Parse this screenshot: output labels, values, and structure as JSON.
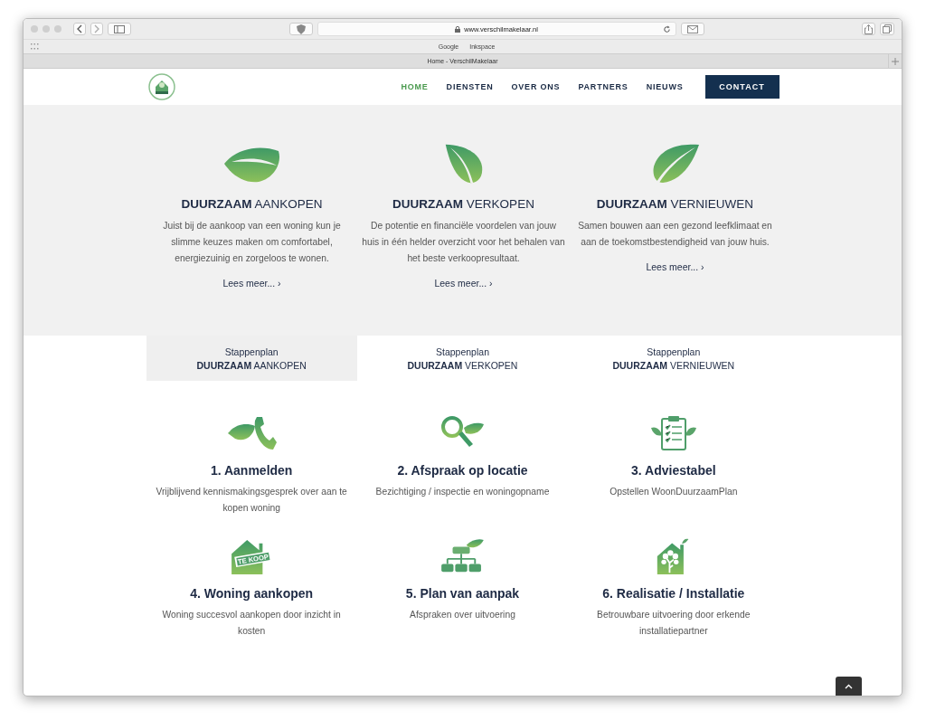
{
  "browser": {
    "url": "www.verschilmakelaar.nl",
    "bookmarks": [
      "Google",
      "Inkspace"
    ],
    "tab_title": "Home - VerschilMakelaar"
  },
  "nav": {
    "items": [
      {
        "label": "HOME",
        "selected": true
      },
      {
        "label": "DIENSTEN",
        "selected": false
      },
      {
        "label": "OVER ONS",
        "selected": false
      },
      {
        "label": "PARTNERS",
        "selected": false
      },
      {
        "label": "NIEUWS",
        "selected": false
      }
    ],
    "button": "CONTACT"
  },
  "features": [
    {
      "title": "**DUURZAAM** AANKOPEN",
      "text": "Juist bij de aankoop van een woning kun je slimme keuzes maken om comfortabel, energiezuinig en zorgeloos te wonen.",
      "link": "Lees meer... ›"
    },
    {
      "title": "**DUURZAAM** VERKOPEN",
      "text": "De potentie en financiële voordelen van jouw huis in één helder overzicht voor het behalen van het beste verkoopresultaat.",
      "link": "Lees meer... ›"
    },
    {
      "title": "**DUURZAAM** VERNIEUWEN",
      "text": "Samen bouwen aan een gezond leefklimaat en aan de toekomstbestendigheid van jouw huis.",
      "link": "Lees meer... ›"
    }
  ],
  "tabs": [
    {
      "caption": "Stappenplan",
      "title": "**DUURZAAM** AANKOPEN",
      "selected": true
    },
    {
      "caption": "Stappenplan",
      "title": "**DUURZAAM** VERKOPEN",
      "selected": false
    },
    {
      "caption": "Stappenplan",
      "title": "**DUURZAAM** VERNIEUWEN",
      "selected": false
    }
  ],
  "steps": [
    {
      "title": "1. Aanmelden",
      "text": "Vrijblijvend kennismakingsgesprek over aan te kopen woning"
    },
    {
      "title": "2. Afspraak op locatie",
      "text": "Bezichtiging / inspectie en woningopname"
    },
    {
      "title": "3. Adviestabel",
      "text": "Opstellen WoonDuurzaamPlan"
    },
    {
      "sign": "TE KOOP",
      "title": "4. Woning aankopen",
      "text": "Woning succesvol aankopen door inzicht in kosten"
    },
    {
      "title": "5. Plan van aanpak",
      "text": "Afspraken over uitvoering"
    },
    {
      "title": "6. Realisatie / Installatie",
      "text": "Betrouwbare uitvoering door erkende installatiepartner"
    }
  ]
}
